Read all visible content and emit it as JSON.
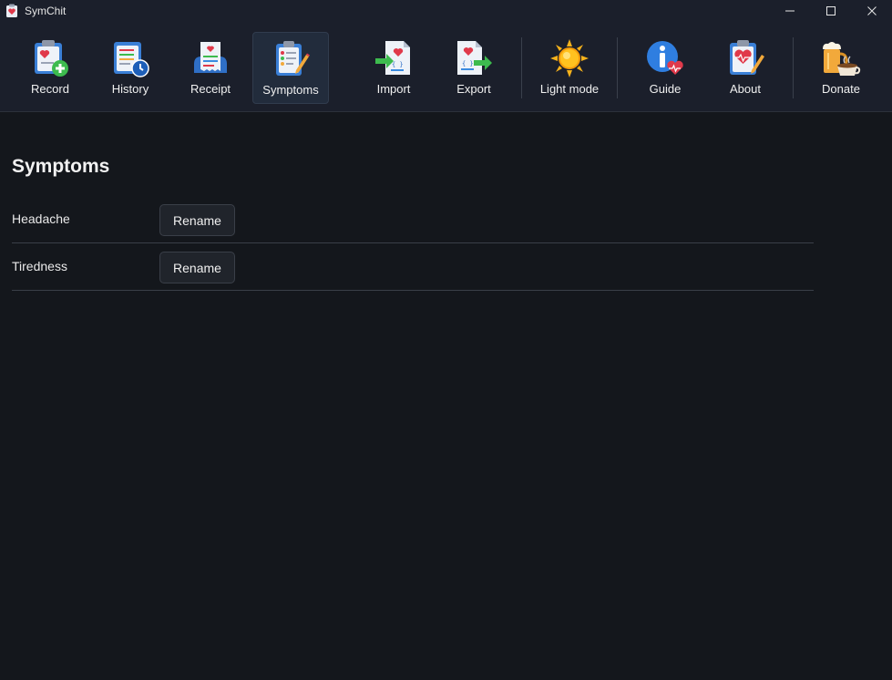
{
  "window": {
    "title": "SymChit"
  },
  "toolbar": {
    "items": [
      {
        "label": "Record",
        "icon": "clipboard-plus-icon",
        "active": false
      },
      {
        "label": "History",
        "icon": "clipboard-clock-icon",
        "active": false
      },
      {
        "label": "Receipt",
        "icon": "receipt-icon",
        "active": false
      },
      {
        "label": "Symptoms",
        "icon": "clipboard-checklist-icon",
        "active": true
      },
      {
        "label": "Import",
        "icon": "json-import-icon",
        "active": false
      },
      {
        "label": "Export",
        "icon": "json-export-icon",
        "active": false
      },
      {
        "label": "Light mode",
        "icon": "sun-icon",
        "active": false
      },
      {
        "label": "Guide",
        "icon": "info-heart-icon",
        "active": false
      },
      {
        "label": "About",
        "icon": "clipboard-heart-icon",
        "active": false
      },
      {
        "label": "Donate",
        "icon": "beer-coffee-icon",
        "active": false
      }
    ]
  },
  "main": {
    "title": "Symptoms",
    "symptoms": [
      {
        "name": "Headache",
        "action": "Rename"
      },
      {
        "name": "Tiredness",
        "action": "Rename"
      }
    ]
  },
  "colors": {
    "background": "#14171c",
    "toolbar": "#1b1f2b",
    "active_tab": "#222c3c",
    "accent_red": "#e0394a",
    "accent_blue": "#3a8be0",
    "accent_green": "#3dbb4e"
  }
}
